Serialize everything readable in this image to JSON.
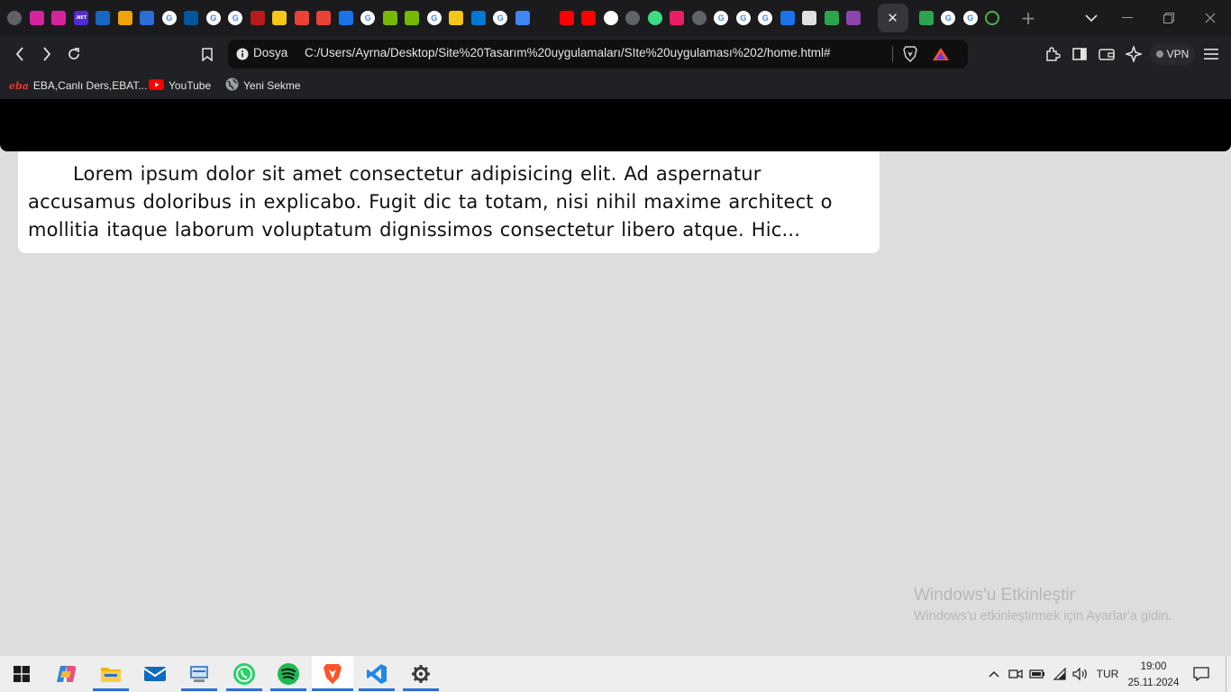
{
  "browser": {
    "tabs": {
      "favicons": [
        {
          "icon": "globe-icon",
          "color": "#5f6368"
        },
        {
          "icon": "instagram-icon",
          "color": "#d6249f"
        },
        {
          "icon": "instagram-icon",
          "color": "#d6249f"
        },
        {
          "icon": "dotnet-icon",
          "color": "#512bd4",
          "label": ".NET"
        },
        {
          "icon": "vuetify-icon",
          "color": "#1867c0"
        },
        {
          "icon": "layers-icon",
          "color": "#f0a30a"
        },
        {
          "icon": "sanity-icon",
          "color": "#2b6fd6"
        },
        {
          "icon": "google-icon",
          "color": "#ffffff"
        },
        {
          "icon": "flutter-icon",
          "color": "#02569b"
        },
        {
          "icon": "google-icon",
          "color": "#ffffff"
        },
        {
          "icon": "google-icon",
          "color": "#ffffff"
        },
        {
          "icon": "shield-icon",
          "color": "#b71c1c"
        },
        {
          "icon": "sparkle-icon",
          "color": "#f5c518"
        },
        {
          "icon": "gmail-icon",
          "color": "#ea4335"
        },
        {
          "icon": "gmail-icon",
          "color": "#ea4335"
        },
        {
          "icon": "flag-icon",
          "color": "#1a73e8"
        },
        {
          "icon": "google-icon",
          "color": "#ffffff"
        },
        {
          "icon": "nvidia-icon",
          "color": "#76b900"
        },
        {
          "icon": "nvidia-icon",
          "color": "#76b900"
        },
        {
          "icon": "google-icon",
          "color": "#ffffff"
        },
        {
          "icon": "sparkle-icon",
          "color": "#f5c518"
        },
        {
          "icon": "outlook-icon",
          "color": "#0078d4"
        },
        {
          "icon": "google-icon",
          "color": "#ffffff"
        },
        {
          "icon": "image-icon",
          "color": "#4285f4"
        },
        {
          "icon": "blank-icon",
          "color": "#1b1b1e"
        },
        {
          "icon": "youtube-icon",
          "color": "#ff0000"
        },
        {
          "icon": "youtube-icon",
          "color": "#ff0000"
        },
        {
          "icon": "chatgpt-icon",
          "color": "#ffffff"
        },
        {
          "icon": "globe-icon",
          "color": "#5f6368"
        },
        {
          "icon": "android-icon",
          "color": "#3ddc84"
        },
        {
          "icon": "pinwheel-icon",
          "color": "#e91e63"
        },
        {
          "icon": "globe-icon",
          "color": "#5f6368"
        },
        {
          "icon": "google-icon",
          "color": "#ffffff"
        },
        {
          "icon": "google-icon",
          "color": "#ffffff"
        },
        {
          "icon": "google-icon",
          "color": "#ffffff"
        },
        {
          "icon": "flag-icon",
          "color": "#1a73e8"
        },
        {
          "icon": "glasses-icon",
          "color": "#e0e0e0"
        },
        {
          "icon": "xb-icon",
          "color": "#2ea44f"
        },
        {
          "icon": "h-icon",
          "color": "#8e44ad"
        }
      ],
      "active_tab_close": "✕",
      "after_active": [
        {
          "icon": "xb-icon",
          "color": "#2ea44f"
        },
        {
          "icon": "google-icon",
          "color": "#ffffff"
        },
        {
          "icon": "google-icon",
          "color": "#ffffff"
        },
        {
          "icon": "power-icon",
          "color": "#4caf50"
        }
      ],
      "new_tab": "+"
    },
    "omnibox": {
      "security_label": "Dosya",
      "url": "C:/Users/Ayrna/Desktop/Site%20Tasarım%20uygulamaları/SIte%20uygulaması%202/home.html#"
    },
    "vpn_label": "VPN",
    "bookmarks": [
      {
        "label": "EBA,Canlı Ders,EBAT...",
        "icon": "eba-icon"
      },
      {
        "label": "YouTube",
        "icon": "youtube-icon"
      },
      {
        "label": "Yeni Sekme",
        "icon": "globe-icon"
      }
    ],
    "colors": {
      "brave_orange": "#fb542b",
      "accent_blue": "#2b6fd6"
    }
  },
  "page": {
    "paragraph": "Lorem ipsum dolor sit amet consectetur adipisicing elit. Ad aspernatur accusamus doloribus in explicabo. Fugit dic ta totam, nisi nihil maxime architect o mollitia itaque laborum voluptatum dignissimos consectetur libero atque. Hic..."
  },
  "watermark": {
    "title": "Windows'u Etkinleştir",
    "subtitle": "Windows'u etkinleştirmek için Ayarlar'a gidin."
  },
  "taskbar": {
    "apps": [
      {
        "name": "start",
        "icon": "windows-icon"
      },
      {
        "name": "copilot",
        "icon": "copilot-icon"
      },
      {
        "name": "file-explorer",
        "icon": "folder-icon"
      },
      {
        "name": "mail",
        "icon": "mail-icon"
      },
      {
        "name": "control-panel",
        "icon": "control-panel-icon"
      },
      {
        "name": "whatsapp",
        "icon": "whatsapp-icon"
      },
      {
        "name": "spotify",
        "icon": "spotify-icon"
      },
      {
        "name": "brave",
        "icon": "brave-icon"
      },
      {
        "name": "vscode",
        "icon": "vscode-icon"
      },
      {
        "name": "settings",
        "icon": "gear-icon"
      }
    ],
    "tray": {
      "language": "TUR",
      "time": "19:00",
      "date": "25.11.2024"
    }
  }
}
